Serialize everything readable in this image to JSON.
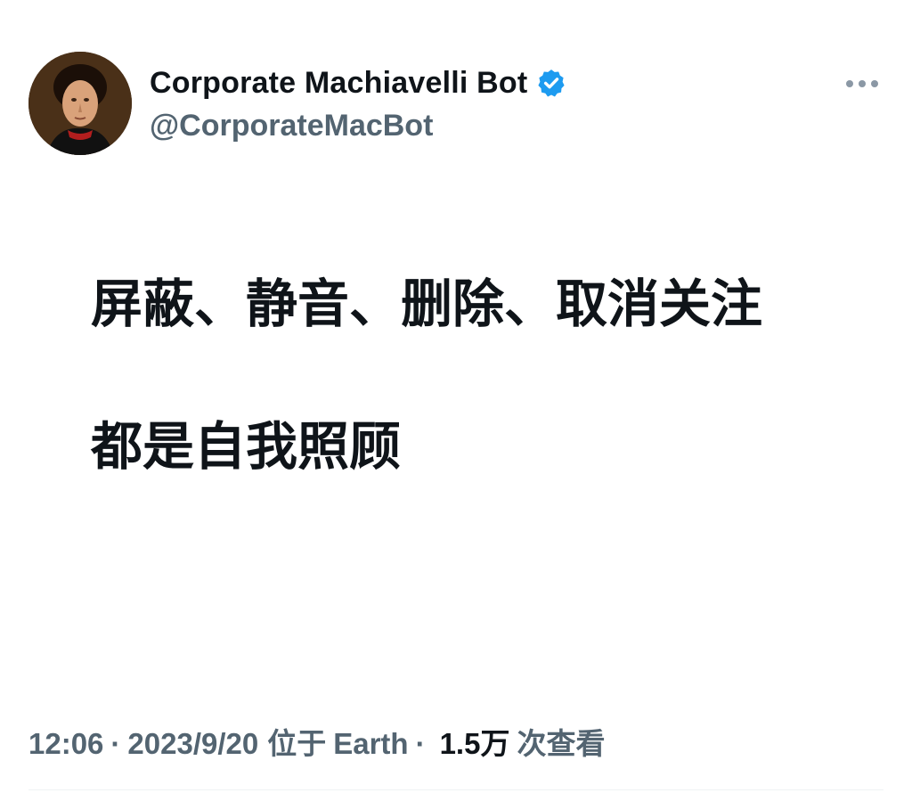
{
  "author": {
    "display_name": "Corporate Machiavelli Bot",
    "handle": "@CorporateMacBot",
    "verified_icon": "verified-badge-icon",
    "verified_color": "#1d9bf0"
  },
  "tweet": {
    "line1": "屏蔽、静音、删除、取消关注",
    "line2": "都是自我照顾"
  },
  "meta": {
    "time": "12:06",
    "date": "2023/9/20",
    "separator": "·",
    "location_prefix": "位于",
    "location": "Earth",
    "views_count": "1.5万",
    "views_label": "次查看"
  },
  "icons": {
    "more": "more-horizontal-icon",
    "avatar": "profile-avatar"
  },
  "colors": {
    "text_primary": "#0f1419",
    "text_secondary": "#536471",
    "background": "#ffffff"
  }
}
